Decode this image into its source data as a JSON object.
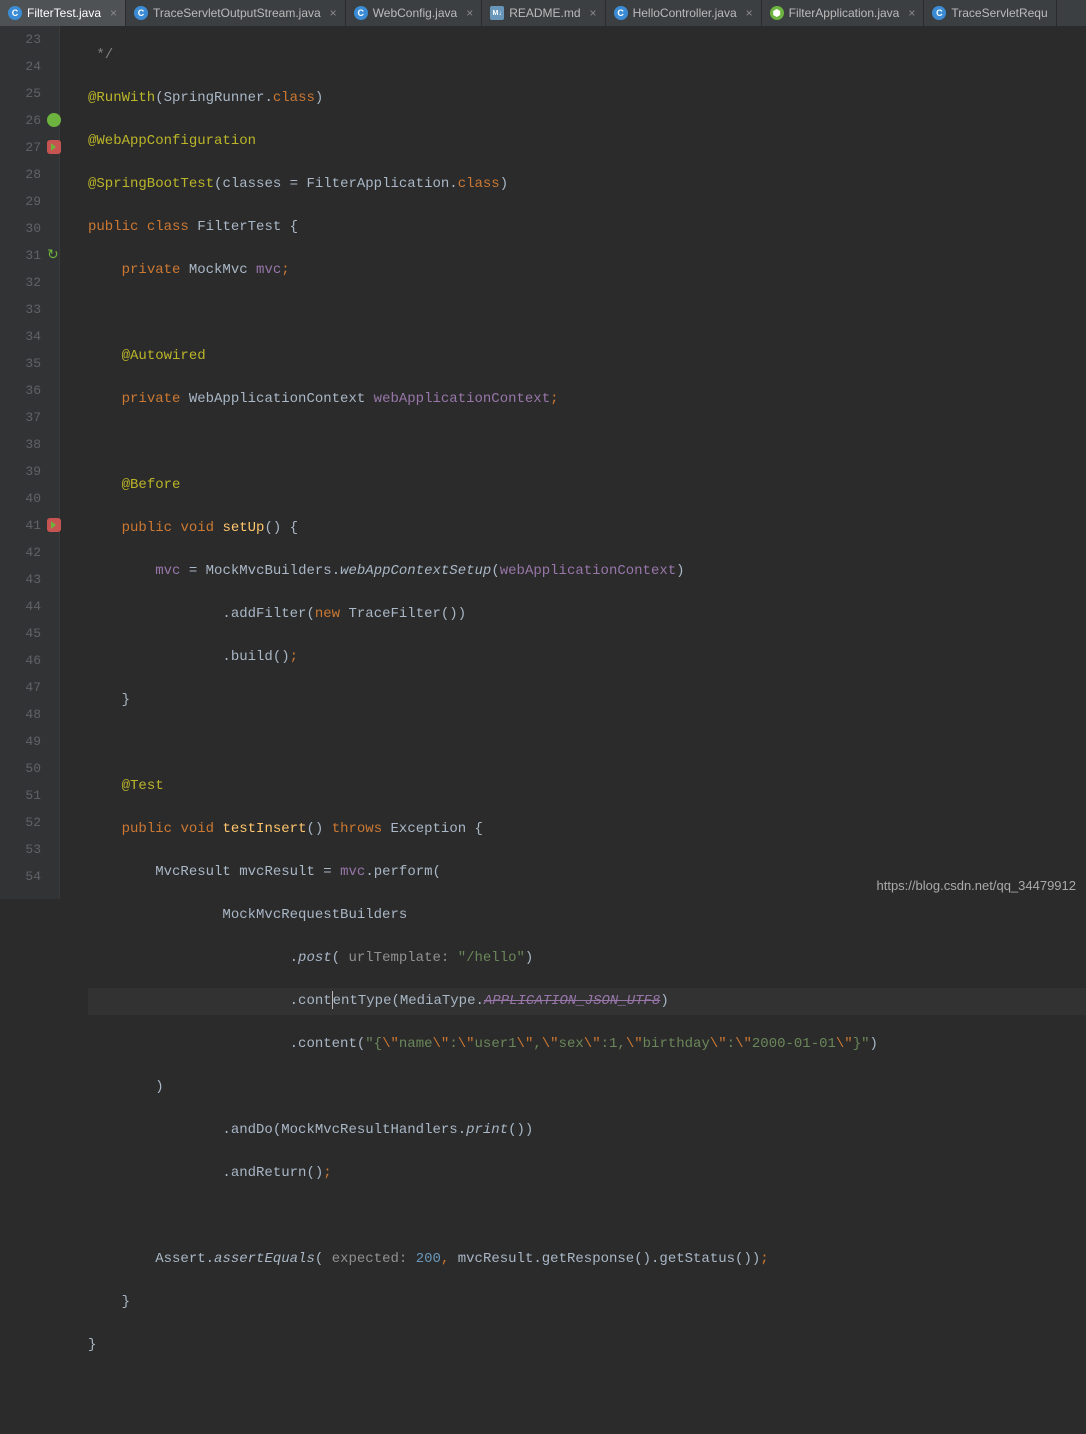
{
  "tabs": [
    {
      "label": "FilterTest.java",
      "icon": "class",
      "active": true
    },
    {
      "label": "TraceServletOutputStream.java",
      "icon": "class",
      "active": false
    },
    {
      "label": "WebConfig.java",
      "icon": "class",
      "active": false
    },
    {
      "label": "README.md",
      "icon": "md",
      "active": false
    },
    {
      "label": "HelloController.java",
      "icon": "class",
      "active": false
    },
    {
      "label": "FilterApplication.java",
      "icon": "boot",
      "active": false
    },
    {
      "label": "TraceServletRequ",
      "icon": "class",
      "active": false,
      "truncated": true
    }
  ],
  "gutter": {
    "start": 23,
    "end": 54
  },
  "code": {
    "l23": " */",
    "l24_anno": "@RunWith",
    "l24_arg": "SpringRunner",
    "l24_kw": "class",
    "l25_anno": "@WebAppConfiguration",
    "l26_anno": "@SpringBootTest",
    "l26_attr": "classes",
    "l26_val": "FilterApplication",
    "l26_kw": "class",
    "l27": {
      "p": "public",
      "c": "class",
      "name": "FilterTest"
    },
    "l28": {
      "kw": "private",
      "type": "MockMvc",
      "fld": "mvc"
    },
    "l30_anno": "@Autowired",
    "l31": {
      "kw": "private",
      "type": "WebApplicationContext",
      "fld": "webApplicationContext"
    },
    "l33_anno": "@Before",
    "l34": {
      "p": "public",
      "v": "void",
      "m": "setUp"
    },
    "l35": {
      "fld": "mvc",
      "cls": "MockMvcBuilders",
      "m": "webAppContextSetup",
      "arg": "webApplicationContext"
    },
    "l36": {
      "m": "addFilter",
      "kw": "new",
      "cls": "TraceFilter"
    },
    "l37": {
      "m": "build"
    },
    "l40_anno": "@Test",
    "l41": {
      "p": "public",
      "v": "void",
      "m": "testInsert",
      "th": "throws",
      "ex": "Exception"
    },
    "l42": {
      "t": "MvcResult",
      "var": "mvcResult",
      "fld": "mvc",
      "m": "perform"
    },
    "l43": {
      "cls": "MockMvcRequestBuilders"
    },
    "l44": {
      "m": "post",
      "hint": "urlTemplate:",
      "str": "\"/hello\""
    },
    "l45": {
      "m": "contentType",
      "cls": "MediaType",
      "con": "APPLICATION_JSON_UTF8"
    },
    "l46": {
      "m": "content",
      "str": "\"{\\\"name\\\":\\\"user1\\\",\\\"sex\\\":1,\\\"birthday\\\":\\\"2000-01-01\\\"}\""
    },
    "l48": {
      "m": "andDo",
      "cls": "MockMvcResultHandlers",
      "m2": "print"
    },
    "l49": {
      "m": "andReturn"
    },
    "l51": {
      "cls": "Assert",
      "m": "assertEquals",
      "hint": "expected:",
      "num": "200",
      "v": "mvcResult",
      "m2": "getResponse",
      "m3": "getStatus"
    }
  },
  "watermark": "https://blog.csdn.net/qq_34479912"
}
